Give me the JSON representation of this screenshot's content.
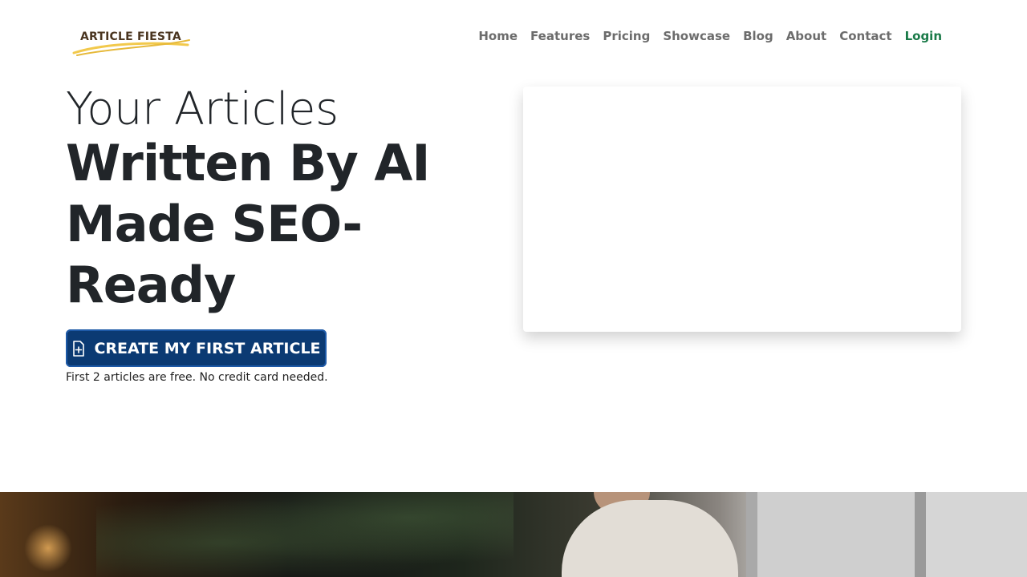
{
  "brand": {
    "name": "ARTICLE FIESTA",
    "swoosh_color": "#f2c94c"
  },
  "nav": [
    {
      "label": "Home",
      "key": "home"
    },
    {
      "label": "Features",
      "key": "features"
    },
    {
      "label": "Pricing",
      "key": "pricing"
    },
    {
      "label": "Showcase",
      "key": "showcase"
    },
    {
      "label": "Blog",
      "key": "blog"
    },
    {
      "label": "About",
      "key": "about"
    },
    {
      "label": "Contact",
      "key": "contact"
    },
    {
      "label": "Login",
      "key": "login"
    }
  ],
  "hero": {
    "line1": "Your Articles",
    "line2": "Written By AI Made SEO-Ready",
    "cta_label": "CREATE MY FIRST ARTICLE",
    "cta_icon": "file-plus-icon",
    "note": "First 2 articles are free. No credit card needed."
  },
  "colors": {
    "cta": "#0b3a73",
    "login": "#1a7a48",
    "nav": "#6c6c6c"
  }
}
